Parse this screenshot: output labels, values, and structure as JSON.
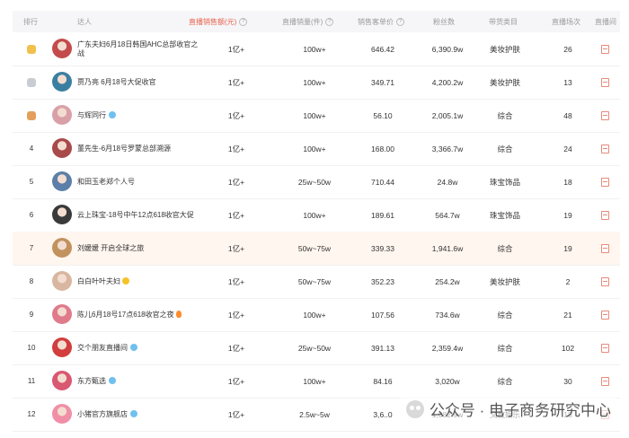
{
  "header": {
    "rank": "排行",
    "influencer": "达人",
    "live_sales": "直播销售额(元)",
    "live_volume": "直播销量(件)",
    "avg_price": "销售客单价",
    "fans": "粉丝数",
    "category": "带货类目",
    "live_times": "直播场次",
    "more": "直播间"
  },
  "colors": {
    "highlight_header": "#e8614e",
    "gold": "#f0c24b",
    "silver": "#c9cdd3",
    "bronze": "#e4a05b",
    "highlight_row": "#fff6ef"
  },
  "rows": [
    {
      "rank": "",
      "medal": "gold",
      "name": "广东夫妇6月18日韩国AHC总部收官之战",
      "sales": "1亿+",
      "volume": "100w+",
      "price": "646.42",
      "fans": "6,390.9w",
      "category": "美妆护肤",
      "times": "26"
    },
    {
      "rank": "",
      "medal": "silver",
      "name": "贾乃亮 6月18号大促收官",
      "sales": "1亿+",
      "volume": "100w+",
      "price": "349.71",
      "fans": "4,200.2w",
      "category": "美妆护肤",
      "times": "13"
    },
    {
      "rank": "",
      "medal": "bronze",
      "name": "与辉同行",
      "verified": true,
      "sales": "1亿+",
      "volume": "100w+",
      "price": "56.10",
      "fans": "2,005.1w",
      "category": "综合",
      "times": "48"
    },
    {
      "rank": "4",
      "name": "董先生-6月18号罗蒙总部溯源",
      "sales": "1亿+",
      "volume": "100w+",
      "price": "168.00",
      "fans": "3,366.7w",
      "category": "综合",
      "times": "24"
    },
    {
      "rank": "5",
      "name": "和田玉老郑个人号",
      "sales": "1亿+",
      "volume": "25w~50w",
      "price": "710.44",
      "fans": "24.8w",
      "category": "珠宝饰品",
      "times": "18"
    },
    {
      "rank": "6",
      "name": "云上珠宝-18号中午12点618收官大促",
      "sales": "1亿+",
      "volume": "100w+",
      "price": "189.61",
      "fans": "564.7w",
      "category": "珠宝饰品",
      "times": "19"
    },
    {
      "rank": "7",
      "name": "刘媛媛 开启全球之旅",
      "highlight": true,
      "sales": "1亿+",
      "volume": "50w~75w",
      "price": "339.33",
      "fans": "1,941.6w",
      "category": "综合",
      "times": "19"
    },
    {
      "rank": "8",
      "name": "白白叶叶夫妇",
      "smile": true,
      "sales": "1亿+",
      "volume": "50w~75w",
      "price": "352.23",
      "fans": "254.2w",
      "category": "美妆护肤",
      "times": "2"
    },
    {
      "rank": "9",
      "name": "陈儿6月18号17点618收官之夜",
      "fire": true,
      "sales": "1亿+",
      "volume": "100w+",
      "price": "107.56",
      "fans": "734.6w",
      "category": "综合",
      "times": "21"
    },
    {
      "rank": "10",
      "name": "交个朋友直播间",
      "verified": true,
      "sales": "1亿+",
      "volume": "25w~50w",
      "price": "391.13",
      "fans": "2,359.4w",
      "category": "综合",
      "times": "102"
    },
    {
      "rank": "11",
      "name": "东方甄选",
      "verified": true,
      "sales": "1亿+",
      "volume": "100w+",
      "price": "84.16",
      "fans": "3,020w",
      "category": "综合",
      "times": "30"
    },
    {
      "rank": "12",
      "name": "小猪官方旗舰店",
      "verified": true,
      "sales": "1亿+",
      "volume": "2.5w~5w",
      "price": "3,6..0",
      "fans": "1,082.9w",
      "category": "文教娱乐",
      "times": "18"
    }
  ],
  "avatar_colors": [
    "#c44b4b",
    "#3b7fa0",
    "#d9a0a8",
    "#a84a4a",
    "#5b7fa8",
    "#3a3a3a",
    "#c2925e",
    "#d8b6a0",
    "#e07b8c",
    "#d23d3d",
    "#d95872",
    "#f08fa6"
  ],
  "watermark": "公众号 · 电子商务研究中心"
}
